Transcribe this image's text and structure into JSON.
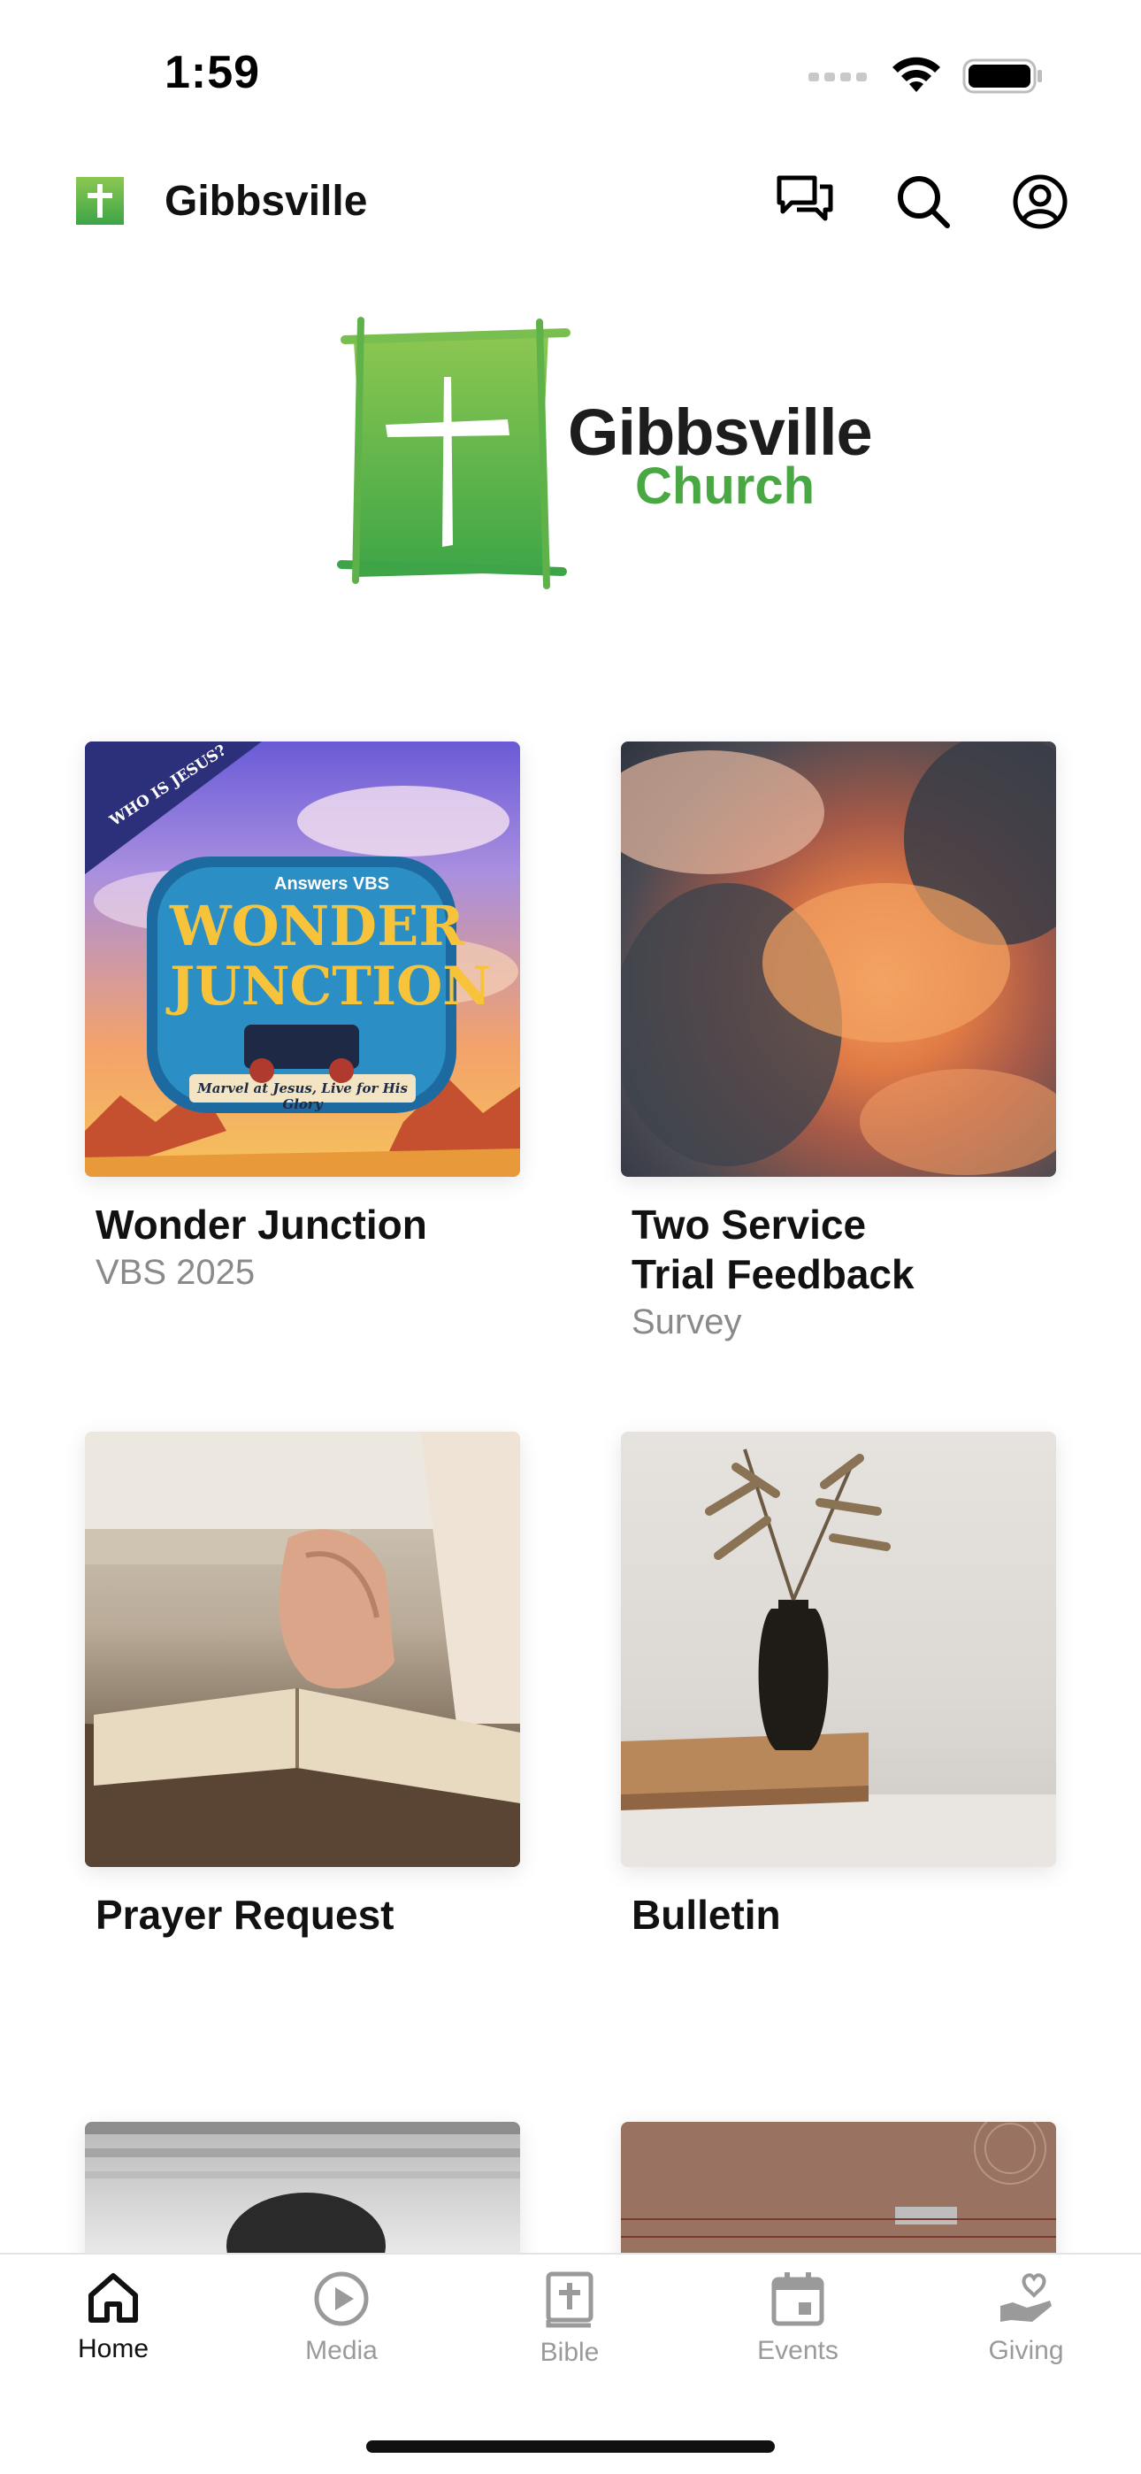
{
  "status_bar": {
    "time": "1:59"
  },
  "header": {
    "title": "Gibbsville",
    "icons": [
      "chat-bubbles-icon",
      "search-icon",
      "profile-icon"
    ]
  },
  "brand": {
    "name": "Gibbsville",
    "subtitle": "Church",
    "colors": {
      "green_light": "#8cc751",
      "green_dark": "#3da547"
    }
  },
  "cards": [
    {
      "title": "Wonder Junction",
      "subtitle": "VBS 2025",
      "art_text": {
        "tag": "WHO IS JESUS?",
        "brand": "Answers VBS",
        "line1": "WONDER",
        "line2": "JUNCTION",
        "tagline": "Marvel at Jesus, Live for His Glory"
      }
    },
    {
      "title_line1": "Two Service",
      "title_line2": "Trial Feedback",
      "subtitle": "Survey"
    },
    {
      "title": "Prayer Request"
    },
    {
      "title": "Bulletin"
    },
    {
      "title": ""
    },
    {
      "title": ""
    }
  ],
  "tab_bar": {
    "items": [
      {
        "label": "Home",
        "icon": "home-icon",
        "active": true
      },
      {
        "label": "Media",
        "icon": "play-circle-icon",
        "active": false
      },
      {
        "label": "Bible",
        "icon": "bible-icon",
        "active": false
      },
      {
        "label": "Events",
        "icon": "calendar-icon",
        "active": false
      },
      {
        "label": "Giving",
        "icon": "giving-hand-icon",
        "active": false
      }
    ]
  }
}
